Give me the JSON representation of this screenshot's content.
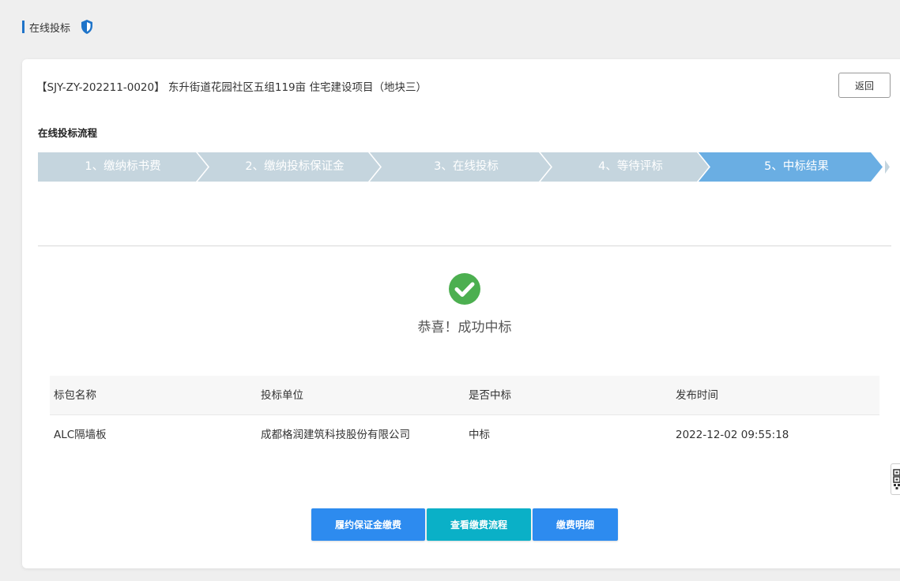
{
  "page": {
    "title": "在线投标"
  },
  "project": {
    "title": "【SJY-ZY-202211-0020】 东升街道花园社区五组119亩 住宅建设项目（地块三）",
    "back_label": "返回"
  },
  "process": {
    "section_title": "在线投标流程",
    "steps": [
      {
        "label": "1、缴纳标书费",
        "active": false
      },
      {
        "label": "2、缴纳投标保证金",
        "active": false
      },
      {
        "label": "3、在线投标",
        "active": false
      },
      {
        "label": "4、等待评标",
        "active": false
      },
      {
        "label": "5、中标结果",
        "active": true
      }
    ]
  },
  "result": {
    "message": "恭喜！成功中标"
  },
  "table": {
    "headers": [
      "标包名称",
      "投标单位",
      "是否中标",
      "发布时间"
    ],
    "rows": [
      [
        "ALC隔墙板",
        "成都格润建筑科技股份有限公司",
        "中标",
        "2022-12-02 09:55:18"
      ]
    ]
  },
  "actions": {
    "performance_bond_label": "履约保证金缴费",
    "payment_flow_label": "查看缴费流程",
    "payment_detail_label": "缴费明细"
  },
  "colors": {
    "step_inactive": "#c5d5de",
    "step_active": "#6aaee3",
    "accent": "#1f74c9",
    "success": "#4caf50",
    "button_blue": "#2d8bef",
    "button_teal": "#0ab0c7"
  },
  "icons": {
    "header": "shield-icon",
    "result": "check-circle-icon",
    "side": "qr-code-icon"
  }
}
